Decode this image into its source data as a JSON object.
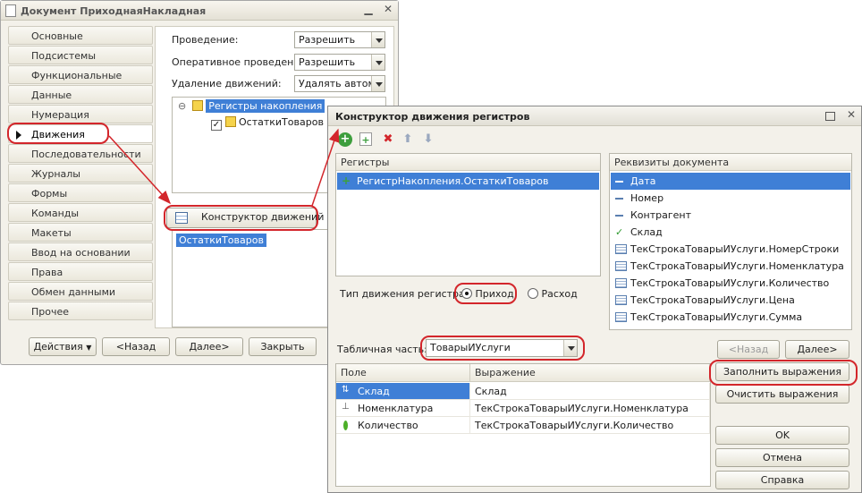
{
  "win1": {
    "title": "Документ ПриходнаяНакладная",
    "nav": [
      "Основные",
      "Подсистемы",
      "Функциональные опции",
      "Данные",
      "Нумерация",
      "Движения",
      "Последовательности",
      "Журналы",
      "Формы",
      "Команды",
      "Макеты",
      "Ввод на основании",
      "Права",
      "Обмен данными",
      "Прочее"
    ],
    "active_index": 5,
    "fields": {
      "posting_label": "Проведение:",
      "posting_value": "Разрешить",
      "oper_label": "Оперативное проведение:",
      "oper_value": "Разрешить",
      "delete_label": "Удаление движений:",
      "delete_value": "Удалять автома"
    },
    "tree": {
      "root": "Регистры накопления",
      "child": "ОстаткиТоваров",
      "child_checked": true
    },
    "constructor_btn": "Конструктор движений",
    "list_item": "ОстаткиТоваров",
    "buttons": {
      "actions": "Действия",
      "back": "<Назад",
      "next": "Далее>",
      "close": "Закрыть"
    }
  },
  "win2": {
    "title": "Конструктор движения регистров",
    "registers_header": "Регистры",
    "registers": [
      "РегистрНакопления.ОстаткиТоваров"
    ],
    "details_header": "Реквизиты документа",
    "details": [
      "Дата",
      "Номер",
      "Контрагент",
      "Склад",
      "ТекСтрокаТоварыИУслуги.НомерСтроки",
      "ТекСтрокаТоварыИУслуги.Номенклатура",
      "ТекСтрокаТоварыИУслуги.Количество",
      "ТекСтрокаТоварыИУслуги.Цена",
      "ТекСтрокаТоварыИУслуги.Сумма"
    ],
    "movement_label": "Тип движения регистра:",
    "movement_in": "Приход",
    "movement_out": "Расход",
    "table_label": "Табличная часть:",
    "table_value": "ТоварыИУслуги",
    "grid_headers": [
      "Поле",
      "Выражение"
    ],
    "grid_rows": [
      {
        "field": "Склад",
        "expr": "Склад"
      },
      {
        "field": "Номенклатура",
        "expr": "ТекСтрокаТоварыИУслуги.Номенклатура"
      },
      {
        "field": "Количество",
        "expr": "ТекСтрокаТоварыИУслуги.Количество"
      }
    ],
    "buttons": {
      "back": "<Назад",
      "next": "Далее>",
      "fill": "Заполнить выражения",
      "clear": "Очистить выражения",
      "ok": "OK",
      "cancel": "Отмена",
      "help": "Справка"
    }
  }
}
